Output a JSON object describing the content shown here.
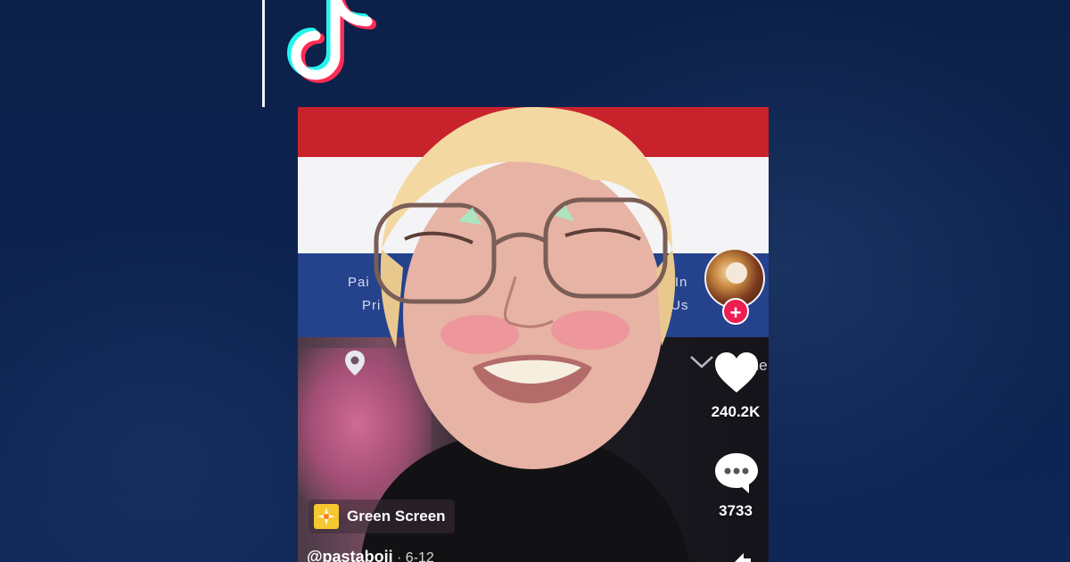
{
  "logo": {
    "name": "tiktok-logo",
    "colors": {
      "cyan": "#25f4ee",
      "pink": "#fe2c55",
      "white": "#ffffff"
    }
  },
  "video": {
    "background_site": {
      "left_line_1": "Pai",
      "left_line_2": "Pri",
      "right_line_1": "nt, In",
      "right_line_2": "act Us",
      "done_label": "Done"
    },
    "effect": {
      "label": "Green Screen",
      "icon": "sparkle-icon"
    },
    "author": {
      "username": "@pastaboii",
      "date": " · 6-12"
    },
    "actions": {
      "likes": "240.2K",
      "comments": "3733",
      "follow_label": "+"
    }
  },
  "colors": {
    "page_bg": "#0d2350",
    "flag_red": "#c8232d",
    "flag_white": "#f4f4f6",
    "flag_blue": "#25428d",
    "follow": "#ee1d52"
  }
}
